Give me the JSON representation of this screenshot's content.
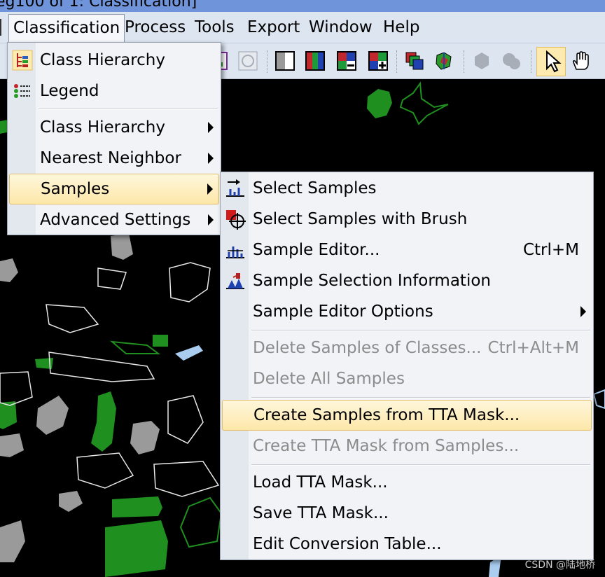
{
  "window": {
    "title_fragment": "eg100 of 1: Classification]"
  },
  "menubar": {
    "items": [
      "Classification",
      "Process",
      "Tools",
      "Export",
      "Window",
      "Help"
    ]
  },
  "classification_menu": {
    "items": [
      {
        "label": "Class Hierarchy",
        "icon": "class-hierarchy-icon"
      },
      {
        "label": "Legend",
        "icon": "legend-icon"
      },
      {
        "label": "Class Hierarchy",
        "submenu": true
      },
      {
        "label": "Nearest Neighbor",
        "submenu": true
      },
      {
        "label": "Samples",
        "submenu": true,
        "highlighted": true
      },
      {
        "label": "Advanced Settings",
        "submenu": true
      }
    ]
  },
  "samples_menu": {
    "items": [
      {
        "label": "Select Samples",
        "icon": "select-samples-icon"
      },
      {
        "label": "Select Samples with Brush",
        "icon": "brush-icon"
      },
      {
        "label": "Sample Editor...",
        "shortcut": "Ctrl+M",
        "icon": "sample-editor-icon"
      },
      {
        "label": "Sample Selection Information",
        "icon": "sample-info-icon"
      },
      {
        "label": "Sample Editor Options",
        "submenu": true
      },
      {
        "label": "Delete Samples of Classes...",
        "shortcut": "Ctrl+Alt+M",
        "disabled": true
      },
      {
        "label": "Delete All Samples",
        "disabled": true
      },
      {
        "label": "Create Samples from TTA Mask...",
        "highlighted": true
      },
      {
        "label": "Create TTA Mask from Samples...",
        "disabled": true
      },
      {
        "label": "Load TTA Mask..."
      },
      {
        "label": "Save TTA Mask..."
      },
      {
        "label": "Edit Conversion Table..."
      }
    ]
  },
  "watermark": "CSDN @陆地桥",
  "colors": {
    "highlight": "#fde7a9",
    "menu_bg": "#f1f3f6",
    "toolbar_bg": "#dde5f1",
    "map_green": "#1f8f1f",
    "map_gray": "#9a9a9a",
    "map_blue": "#a9ccef"
  }
}
